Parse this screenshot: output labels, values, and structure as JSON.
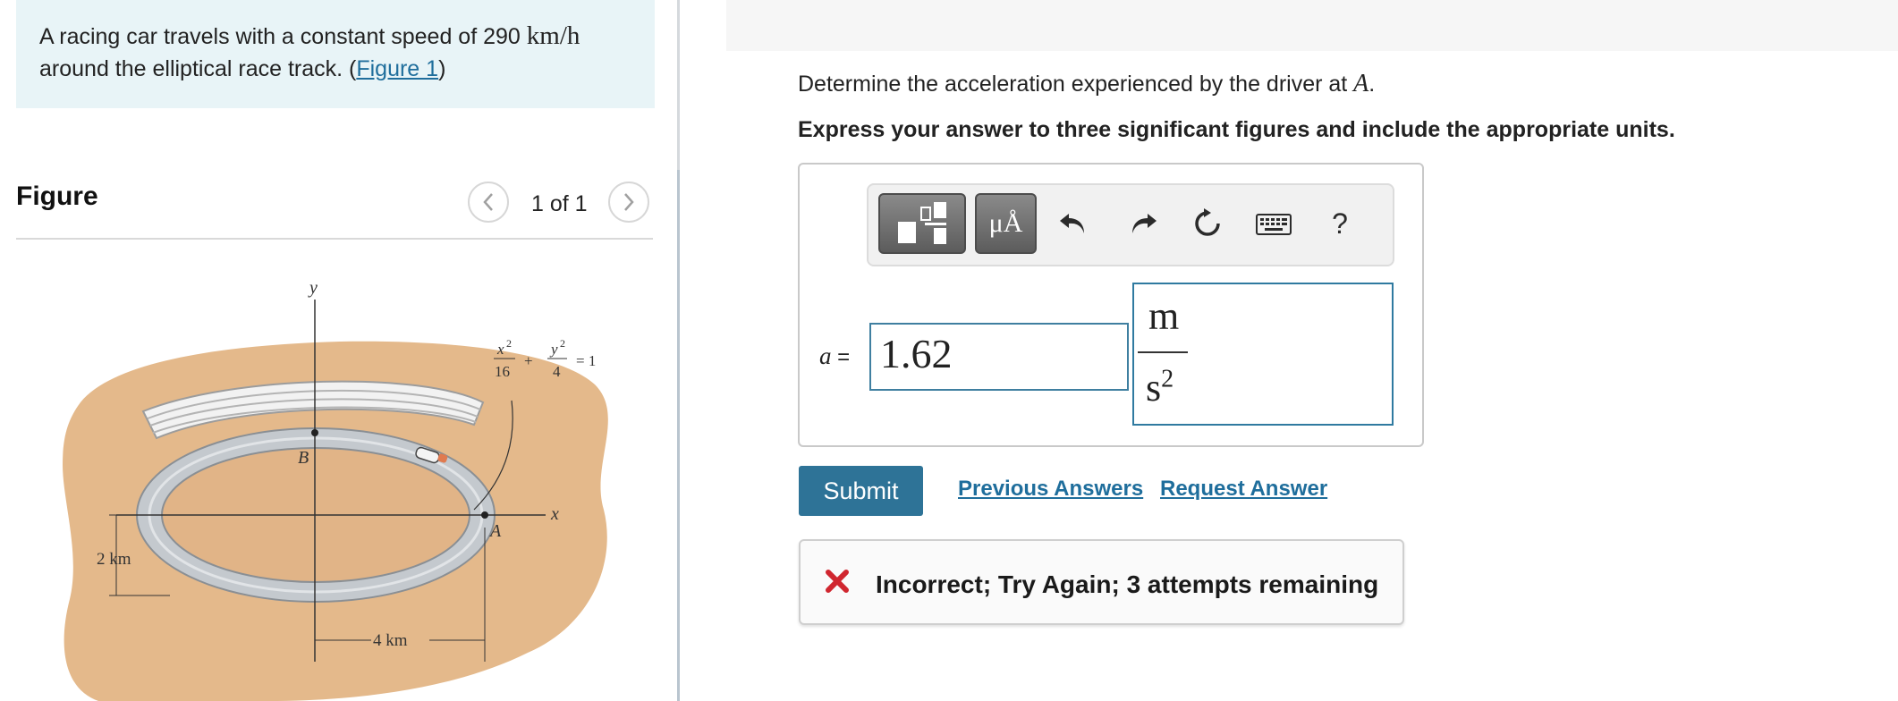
{
  "problem": {
    "text_before": "A racing car travels with a constant speed of 290 ",
    "speed_unit": "km/h",
    "text_after": "around the elliptical race track. (",
    "figure_link": "Figure 1",
    "text_close": ")"
  },
  "figure_panel": {
    "title": "Figure",
    "pager": "1 of 1",
    "diagram": {
      "axis_y": "y",
      "axis_x": "x",
      "label_B": "B",
      "label_A": "A",
      "dim_vertical": "2 km",
      "dim_horizontal": "4 km",
      "eq_x_num": "x",
      "eq_x_exp": "2",
      "eq_x_den": "16",
      "eq_y_num": "y",
      "eq_y_exp": "2",
      "eq_y_den": "4",
      "eq_plus": "+",
      "eq_rhs": "= 1"
    }
  },
  "question": {
    "prefix": "Determine the acceleration experienced by the driver at ",
    "point": "A",
    "suffix": ".",
    "instruction": "Express your answer to three significant figures and include the appropriate units."
  },
  "toolbar": {
    "units_button_label": "μÅ",
    "help_label": "?"
  },
  "answer": {
    "variable": "a",
    "equals": "=",
    "value": "1.62",
    "unit_numerator": "m",
    "unit_denominator": "s",
    "unit_denominator_exp": "2"
  },
  "actions": {
    "submit": "Submit",
    "previous_answers": "Previous Answers",
    "request_answer": "Request Answer"
  },
  "feedback": {
    "message": "Incorrect; Try Again; 3 attempts remaining",
    "status_color": "#d0262f"
  },
  "colors": {
    "accent": "#2e7397",
    "link": "#1f6e9c",
    "problem_bg": "#e8f4f7"
  }
}
